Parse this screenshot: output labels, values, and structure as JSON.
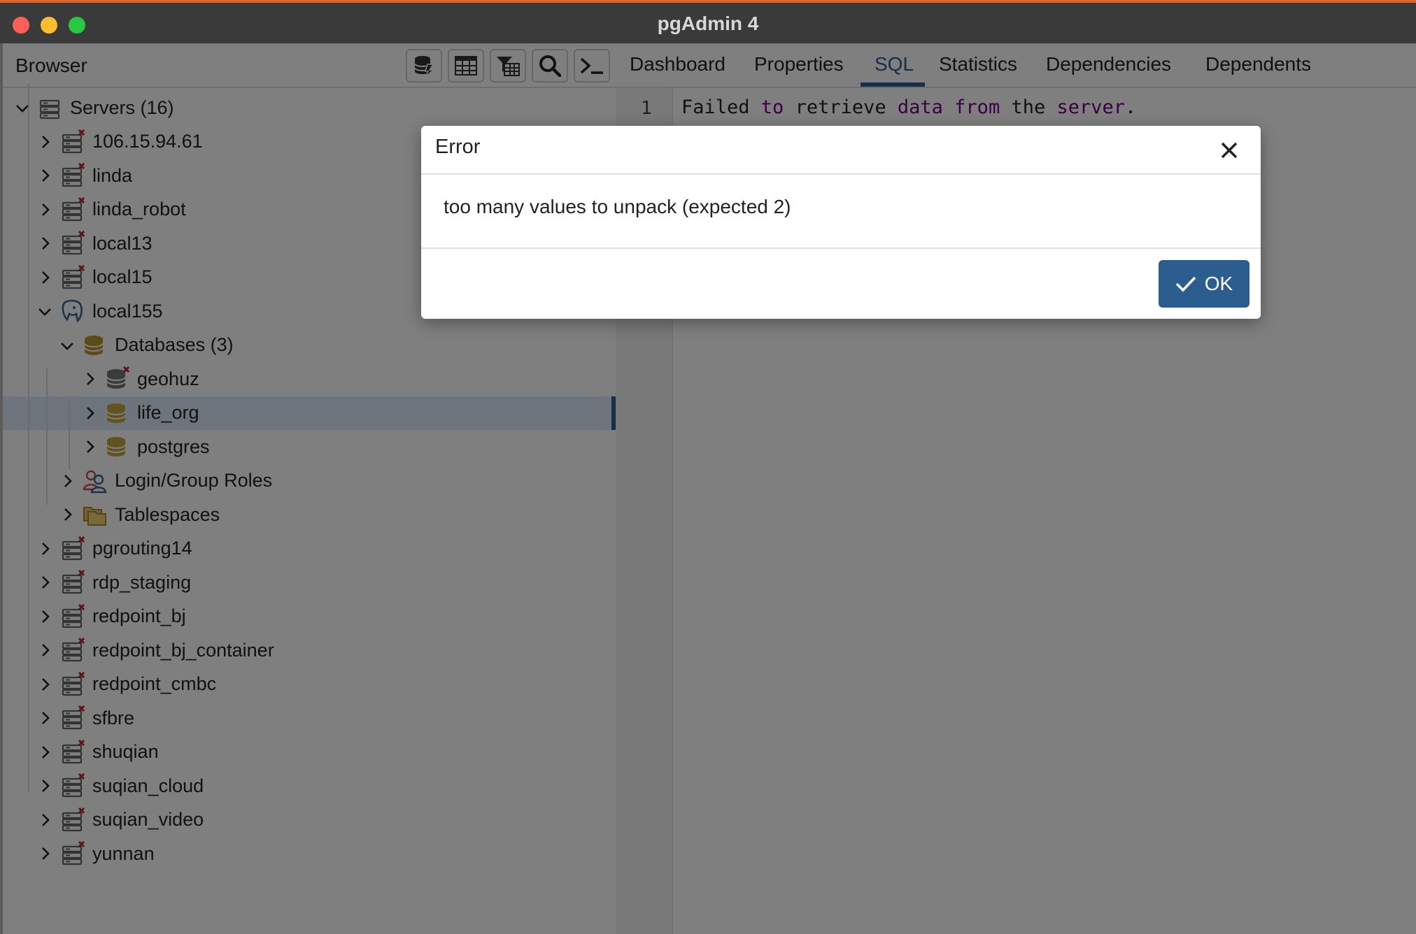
{
  "window": {
    "title": "pgAdmin 4"
  },
  "browser": {
    "title": "Browser",
    "tree": [
      {
        "label": "Servers (16)",
        "level": 0,
        "expanded": true,
        "icon": "servers-icon"
      },
      {
        "label": "106.15.94.61",
        "level": 1,
        "expanded": false,
        "icon": "server-disconnected-icon"
      },
      {
        "label": "linda",
        "level": 1,
        "expanded": false,
        "icon": "server-disconnected-icon"
      },
      {
        "label": "linda_robot",
        "level": 1,
        "expanded": false,
        "icon": "server-disconnected-icon"
      },
      {
        "label": "local13",
        "level": 1,
        "expanded": false,
        "icon": "server-disconnected-icon"
      },
      {
        "label": "local15",
        "level": 1,
        "expanded": false,
        "icon": "server-disconnected-icon"
      },
      {
        "label": "local155",
        "level": 1,
        "expanded": true,
        "icon": "postgres-elephant-icon"
      },
      {
        "label": "Databases (3)",
        "level": 2,
        "expanded": true,
        "icon": "databases-icon"
      },
      {
        "label": "geohuz",
        "level": 3,
        "expanded": false,
        "icon": "database-disconnected-icon"
      },
      {
        "label": "life_org",
        "level": 3,
        "expanded": false,
        "icon": "database-icon",
        "selected": true
      },
      {
        "label": "postgres",
        "level": 3,
        "expanded": false,
        "icon": "database-icon"
      },
      {
        "label": "Login/Group Roles",
        "level": 2,
        "expanded": false,
        "icon": "roles-icon"
      },
      {
        "label": "Tablespaces",
        "level": 2,
        "expanded": false,
        "icon": "tablespaces-icon"
      },
      {
        "label": "pgrouting14",
        "level": 1,
        "expanded": false,
        "icon": "server-disconnected-icon"
      },
      {
        "label": "rdp_staging",
        "level": 1,
        "expanded": false,
        "icon": "server-disconnected-icon"
      },
      {
        "label": "redpoint_bj",
        "level": 1,
        "expanded": false,
        "icon": "server-disconnected-icon"
      },
      {
        "label": "redpoint_bj_container",
        "level": 1,
        "expanded": false,
        "icon": "server-disconnected-icon"
      },
      {
        "label": "redpoint_cmbc",
        "level": 1,
        "expanded": false,
        "icon": "server-disconnected-icon"
      },
      {
        "label": "sfbre",
        "level": 1,
        "expanded": false,
        "icon": "server-disconnected-icon"
      },
      {
        "label": "shuqian",
        "level": 1,
        "expanded": false,
        "icon": "server-disconnected-icon"
      },
      {
        "label": "suqian_cloud",
        "level": 1,
        "expanded": false,
        "icon": "server-disconnected-icon"
      },
      {
        "label": "suqian_video",
        "level": 1,
        "expanded": false,
        "icon": "server-disconnected-icon"
      },
      {
        "label": "yunnan",
        "level": 1,
        "expanded": false,
        "icon": "server-disconnected-icon"
      }
    ]
  },
  "tabs": [
    {
      "label": "Dashboard",
      "active": false
    },
    {
      "label": "Properties",
      "active": false
    },
    {
      "label": "SQL",
      "active": true
    },
    {
      "label": "Statistics",
      "active": false
    },
    {
      "label": "Dependencies",
      "active": false
    },
    {
      "label": "Dependents",
      "active": false
    }
  ],
  "editor": {
    "line_number": "1",
    "tokens": [
      {
        "text": "Failed ",
        "kw": false
      },
      {
        "text": "to",
        "kw": true
      },
      {
        "text": " retrieve ",
        "kw": false
      },
      {
        "text": "data",
        "kw": true
      },
      {
        "text": " ",
        "kw": false
      },
      {
        "text": "from",
        "kw": true
      },
      {
        "text": " the ",
        "kw": false
      },
      {
        "text": "server",
        "kw": true
      },
      {
        "text": ".",
        "kw": false
      }
    ]
  },
  "dialog": {
    "title": "Error",
    "message": "too many values to unpack (expected 2)",
    "ok_label": "OK"
  },
  "colors": {
    "accent": "#2c5d8f",
    "keyword": "#770088",
    "titlebar": "#3a3a3a"
  }
}
